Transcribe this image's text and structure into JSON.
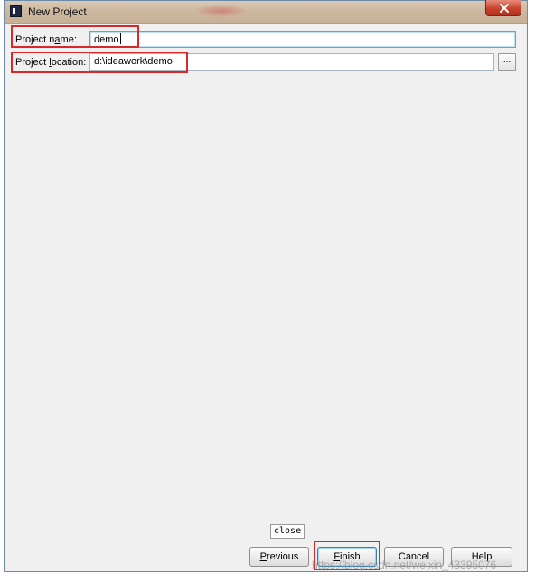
{
  "window": {
    "title": "New Project"
  },
  "form": {
    "name_label_pre": "Project n",
    "name_label_ul": "a",
    "name_label_post": "me:",
    "name_value": "demo",
    "location_label_pre": "Project ",
    "location_label_ul": "l",
    "location_label_post": "ocation:",
    "location_value": "d:\\ideawork\\demo",
    "browse_label": "..."
  },
  "tooltip": {
    "text": "close"
  },
  "buttons": {
    "previous_ul": "P",
    "previous_rest": "revious",
    "finish_ul": "F",
    "finish_rest": "inish",
    "cancel": "Cancel",
    "help": "Help"
  },
  "watermark": {
    "text": "https://blog.csdn.net/weixin_43395076"
  },
  "colors": {
    "highlight": "#d9282a",
    "accent": "#3c7fb1",
    "close_button": "#c7432e"
  },
  "icons": [
    "intellij-app-icon",
    "close-icon"
  ]
}
